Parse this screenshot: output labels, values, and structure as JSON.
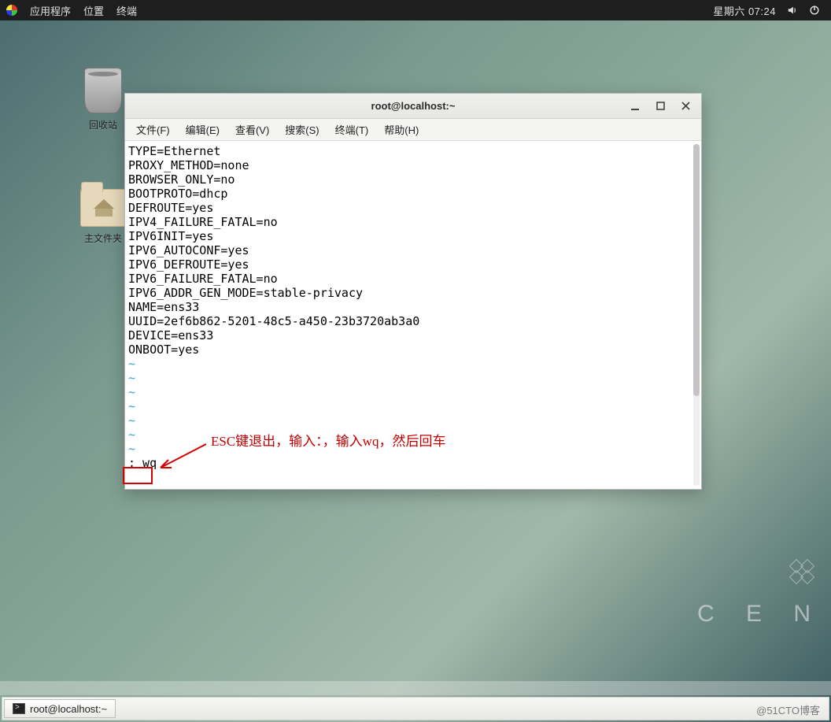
{
  "topbar": {
    "menus": [
      "应用程序",
      "位置",
      "终端"
    ],
    "clock": "星期六 07:24"
  },
  "desktop": {
    "trash_label": "回收站",
    "home_label": "主文件夹"
  },
  "terminal": {
    "title": "root@localhost:~",
    "menus": {
      "file": "文件(F)",
      "edit": "编辑(E)",
      "view": "查看(V)",
      "search": "搜索(S)",
      "terminal": "终端(T)",
      "help": "帮助(H)"
    },
    "lines": [
      "TYPE=Ethernet",
      "PROXY_METHOD=none",
      "BROWSER_ONLY=no",
      "BOOTPROTO=dhcp",
      "DEFROUTE=yes",
      "IPV4_FAILURE_FATAL=no",
      "IPV6INIT=yes",
      "IPV6_AUTOCONF=yes",
      "IPV6_DEFROUTE=yes",
      "IPV6_FAILURE_FATAL=no",
      "IPV6_ADDR_GEN_MODE=stable-privacy",
      "NAME=ens33",
      "UUID=2ef6b862-5201-48c5-a450-23b3720ab3a0",
      "DEVICE=ens33",
      "ONBOOT=yes"
    ],
    "empty_line_marker": "~",
    "empty_line_count": 7,
    "command_line": ": wq"
  },
  "annotation": {
    "text": "ESC键退出，输入：，输入wq，然后回车"
  },
  "centos": {
    "text": "C E N"
  },
  "taskbar": {
    "task1": "root@localhost:~"
  },
  "watermark": "@51CTO博客"
}
